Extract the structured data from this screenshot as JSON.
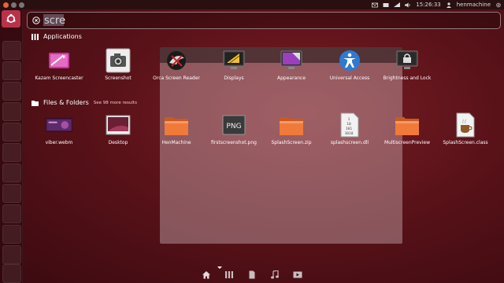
{
  "panel": {
    "clock": "15:26:33",
    "user": "henmachine"
  },
  "search": {
    "query": "scre"
  },
  "sections": {
    "applications": {
      "title": "Applications"
    },
    "files": {
      "title": "Files & Folders",
      "see_more": "See 98 more results"
    }
  },
  "applications": [
    {
      "label": "Kazam Screencaster",
      "icon": "kazam-icon"
    },
    {
      "label": "Screenshot",
      "icon": "screenshot-icon"
    },
    {
      "label": "Orca Screen Reader",
      "icon": "orca-icon"
    },
    {
      "label": "Displays",
      "icon": "displays-icon"
    },
    {
      "label": "Appearance",
      "icon": "appearance-icon"
    },
    {
      "label": "Universal Access",
      "icon": "universal-access-icon"
    },
    {
      "label": "Brightness and Lock",
      "icon": "brightness-lock-icon"
    }
  ],
  "files": [
    {
      "label": "viber.webm",
      "icon": "video-thumbnail-icon"
    },
    {
      "label": "Desktop",
      "icon": "desktop-folder-icon"
    },
    {
      "label": "HenMachine",
      "icon": "folder-icon"
    },
    {
      "label": "firstscreenshot.png",
      "icon": "png-file-icon"
    },
    {
      "label": "SplashScreen.zip",
      "icon": "zip-folder-icon"
    },
    {
      "label": "splashscreen.dll",
      "icon": "binary-file-icon"
    },
    {
      "label": "MultiscreenPreview",
      "icon": "folder-icon"
    },
    {
      "label": "SplashScreen.class",
      "icon": "java-class-icon"
    }
  ],
  "png_badge": "PNG",
  "binary_badge": [
    "1",
    "10",
    "101",
    "1010"
  ],
  "colors": {
    "accent": "#e3653c",
    "folder": "#f07a3a",
    "bfb": "#b8334a"
  }
}
